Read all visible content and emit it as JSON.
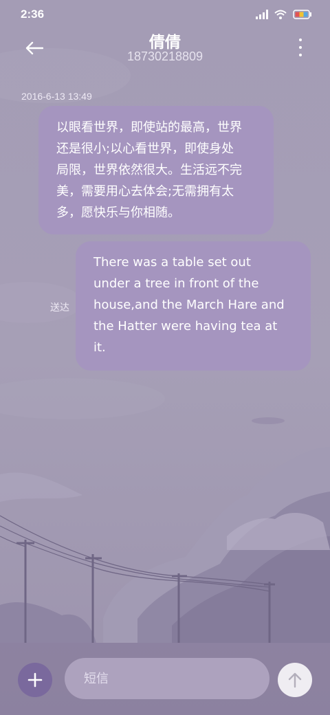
{
  "status_bar": {
    "time": "2:36",
    "icons": [
      "signal-icon",
      "wifi-icon",
      "battery-icon"
    ]
  },
  "header": {
    "contact_name": "倩倩",
    "contact_number": "18730218809",
    "back_icon": "back-arrow-icon",
    "more_icon": "more-vertical-icon"
  },
  "conversation": {
    "timestamp": "2016-6-13 13:49",
    "messages": [
      {
        "direction": "incoming",
        "lines": [
          "以眼看世界，即使站的最高，世界",
          "还是很小;以心看世界，即使身处",
          "局限，世界依然很大。生活远不完",
          "美，需要用心去体会;无需拥有太",
          "多，愿快乐与你相随。"
        ]
      },
      {
        "direction": "outgoing",
        "status": "送达",
        "lines": [
          "There was a table set out",
          "under a tree in front of the",
          "house,and the March Hare and",
          "the Hatter were having tea at",
          "it."
        ]
      }
    ]
  },
  "input_bar": {
    "add_icon": "plus-icon",
    "placeholder": "短信",
    "send_icon": "send-arrow-icon"
  },
  "colors": {
    "background": "#a39bb5",
    "bubble": "#a595bf",
    "add_button": "#7a699d",
    "send_button": "#efedf2"
  }
}
